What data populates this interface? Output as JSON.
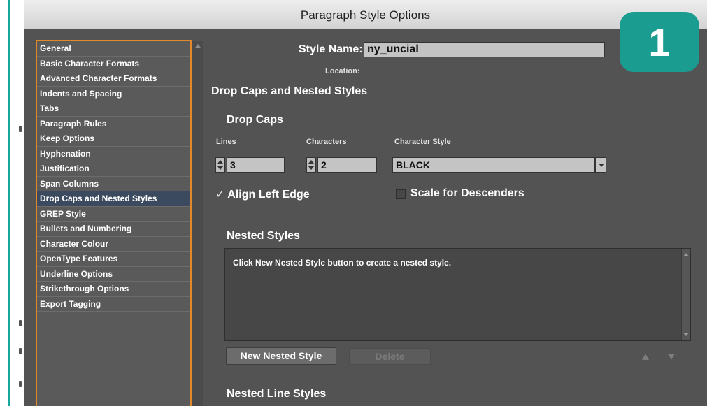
{
  "window": {
    "title": "Paragraph Style Options"
  },
  "categories": [
    "General",
    "Basic Character Formats",
    "Advanced Character Formats",
    "Indents and Spacing",
    "Tabs",
    "Paragraph Rules",
    "Keep Options",
    "Hyphenation",
    "Justification",
    "Span Columns",
    "Drop Caps and Nested Styles",
    "GREP Style",
    "Bullets and Numbering",
    "Character Colour",
    "OpenType Features",
    "Underline Options",
    "Strikethrough Options",
    "Export Tagging"
  ],
  "selected_category": "Drop Caps and Nested Styles",
  "style_name": {
    "label": "Style Name:",
    "value": "ny_uncial"
  },
  "location": {
    "label": "Location:"
  },
  "section_title": "Drop Caps and Nested Styles",
  "drop_caps": {
    "title": "Drop Caps",
    "lines_label": "Lines",
    "lines_value": "3",
    "characters_label": "Characters",
    "characters_value": "2",
    "char_style_label": "Character Style",
    "char_style_value": "BLACK",
    "align_left_edge": {
      "label": "Align Left Edge",
      "checked": true,
      "check_glyph": "✓"
    },
    "scale_for_descenders": {
      "label": "Scale for Descenders",
      "checked": false
    }
  },
  "nested_styles": {
    "title": "Nested Styles",
    "empty_message": "Click New Nested Style button to create a nested style.",
    "new_button": "New Nested Style",
    "delete_button": "Delete"
  },
  "nested_line_styles": {
    "title": "Nested Line Styles"
  },
  "step_badge": "1",
  "colors": {
    "accent": "#17a79c",
    "highlight": "#e08a2c",
    "selection": "#3b4a5f",
    "panel": "#535353"
  }
}
